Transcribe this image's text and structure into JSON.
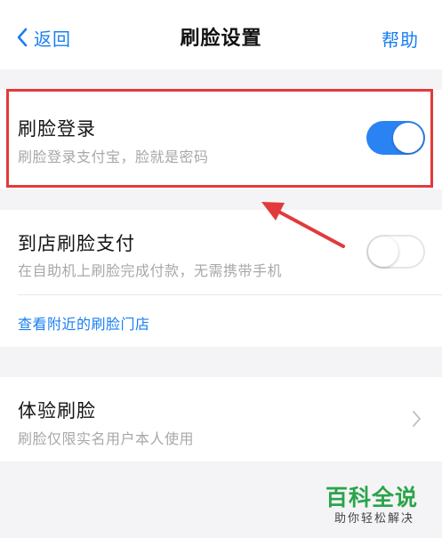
{
  "header": {
    "back_label": "返回",
    "title": "刷脸设置",
    "help_label": "帮助"
  },
  "settings": {
    "face_login": {
      "title": "刷脸登录",
      "subtitle": "刷脸登录支付宝，脸就是密码",
      "enabled": true
    },
    "store_payment": {
      "title": "到店刷脸支付",
      "subtitle": "在自助机上刷脸完成付款，无需携带手机",
      "enabled": false,
      "link_label": "查看附近的刷脸门店"
    },
    "trial": {
      "title": "体验刷脸",
      "subtitle": "刷脸仅限实名用户本人使用"
    }
  },
  "watermark": {
    "main": "百科全说",
    "sub": "助你轻松解决"
  },
  "colors": {
    "accent": "#1a7ff2",
    "toggle_on": "#2b82f3",
    "highlight": "#e23a3a",
    "watermark": "#2aa44a"
  },
  "icons": {
    "back": "chevron-left-icon",
    "disclosure": "chevron-right-icon",
    "annotation": "arrow-icon"
  }
}
